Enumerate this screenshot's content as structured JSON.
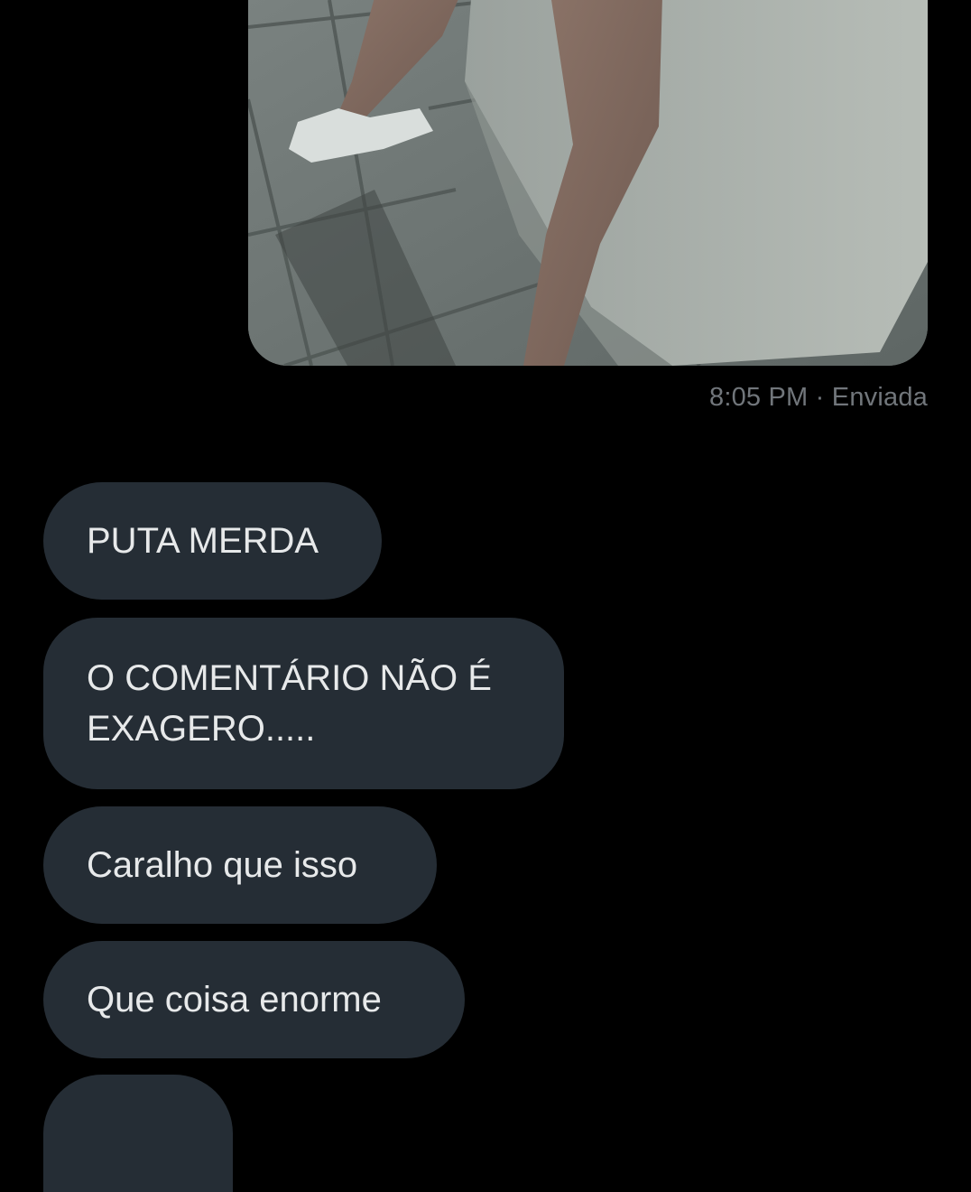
{
  "conversation": {
    "sent": {
      "media_description_icon": "photo-attachment",
      "time": "8:05 PM",
      "separator": "·",
      "status": "Enviada"
    },
    "received": [
      {
        "text": "PUTA MERDA"
      },
      {
        "text": "O COMENTÁRIO NÃO É EXAGERO....."
      },
      {
        "text": "Caralho que isso"
      },
      {
        "text": "Que coisa enorme"
      },
      {
        "text": ""
      }
    ]
  },
  "colors": {
    "background": "#000000",
    "received_bubble": "#252d35",
    "text": "#e7e9ea",
    "meta_text": "#71767b"
  }
}
